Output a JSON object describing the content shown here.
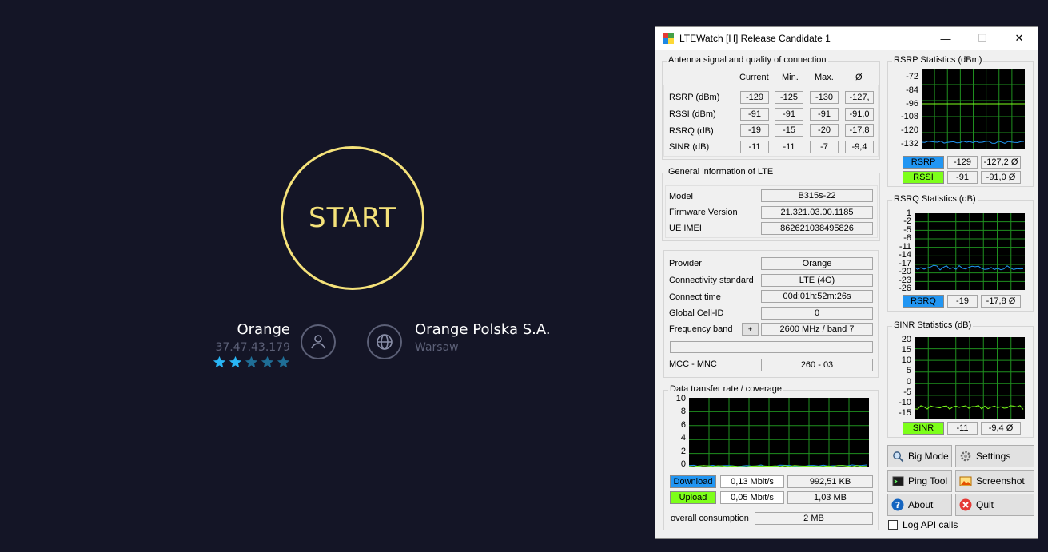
{
  "speedtest": {
    "start_label": "START",
    "isp": {
      "name": "Orange",
      "ip": "37.47.43.179",
      "rating": 2,
      "rating_max": 5
    },
    "server": {
      "name": "Orange Polska S.A.",
      "city": "Warsaw"
    },
    "colors": {
      "accent": "#f5e27a",
      "star_on": "#29b6f6",
      "star_off": "#1f6e96",
      "muted": "#5c6077"
    },
    "icons": {
      "user": "user-icon",
      "globe": "globe-icon"
    }
  },
  "window": {
    "title": "LTEWatch [H]   Release Candidate 1",
    "controls": {
      "minimize": "—",
      "maximize": "☐",
      "close": "✕"
    }
  },
  "antenna": {
    "title": "Antenna signal and quality of connection",
    "headers": [
      "Current",
      "Min.",
      "Max.",
      "Ø"
    ],
    "rows": [
      {
        "label": "RSRP (dBm)",
        "values": [
          "-129",
          "-125",
          "-130",
          "-127,"
        ]
      },
      {
        "label": "RSSI (dBm)",
        "values": [
          "-91",
          "-91",
          "-91",
          "-91,0"
        ]
      },
      {
        "label": "RSRQ (dB)",
        "values": [
          "-19",
          "-15",
          "-20",
          "-17,8"
        ]
      },
      {
        "label": "SINR (dB)",
        "values": [
          "-11",
          "-11",
          "-7",
          "-9,4"
        ]
      }
    ]
  },
  "general": {
    "title": "General information of LTE",
    "rows": [
      {
        "label": "Model",
        "value": "B315s-22"
      },
      {
        "label": "Firmware Version",
        "value": "21.321.03.00.1185"
      },
      {
        "label": "UE IMEI",
        "value": "862621038495826"
      }
    ]
  },
  "provider": {
    "rows": [
      {
        "label": "Provider",
        "value": "Orange"
      },
      {
        "label": "Connectivity standard",
        "value": "LTE (4G)"
      },
      {
        "label": "Connect time",
        "value": "00d:01h:52m:26s"
      },
      {
        "label": "Global Cell-ID",
        "value": "0"
      },
      {
        "label": "Frequency band",
        "value": "2600 MHz / band 7"
      }
    ],
    "expand_label": "+",
    "mcc_label": "MCC - MNC",
    "mcc_value": "260 - 03"
  },
  "transfer": {
    "title": "Data transfer rate / coverage",
    "y_ticks": [
      "10",
      "8",
      "6",
      "4",
      "2",
      "0"
    ],
    "download": {
      "label": "Download",
      "rate": "0,13 Mbit/s",
      "total": "992,51 KB"
    },
    "upload": {
      "label": "Upload",
      "rate": "0,05 Mbit/s",
      "total": "1,03 MB"
    },
    "overall_label": "overall consumption",
    "overall_value": "2 MB"
  },
  "rsrp_stats": {
    "title": "RSRP Statistics (dBm)",
    "y_ticks": [
      "-72",
      "-84",
      "-96",
      "-108",
      "-120",
      "-132"
    ],
    "legend": [
      {
        "label": "RSRP",
        "current": "-129",
        "avg": "-127,2 Ø"
      },
      {
        "label": "RSSI",
        "current": "-91",
        "avg": "-91,0 Ø"
      }
    ]
  },
  "rsrq_stats": {
    "title": "RSRQ Statistics (dB)",
    "y_ticks": [
      "1",
      "-2",
      "-5",
      "-8",
      "-11",
      "-14",
      "-17",
      "-20",
      "-23",
      "-26"
    ],
    "legend": [
      {
        "label": "RSRQ",
        "current": "-19",
        "avg": "-17,8 Ø"
      }
    ]
  },
  "sinr_stats": {
    "title": "SINR Statistics (dB)",
    "y_ticks": [
      "20",
      "15",
      "10",
      "5",
      "0",
      "-5",
      "-10",
      "-15"
    ],
    "legend": [
      {
        "label": "SINR",
        "current": "-11",
        "avg": "-9,4 Ø"
      }
    ]
  },
  "buttons": {
    "big_mode": "Big Mode",
    "settings": "Settings",
    "ping_tool": "Ping Tool",
    "screenshot": "Screenshot",
    "about": "About",
    "quit": "Quit"
  },
  "log_api": {
    "label": "Log API calls",
    "checked": false
  }
}
